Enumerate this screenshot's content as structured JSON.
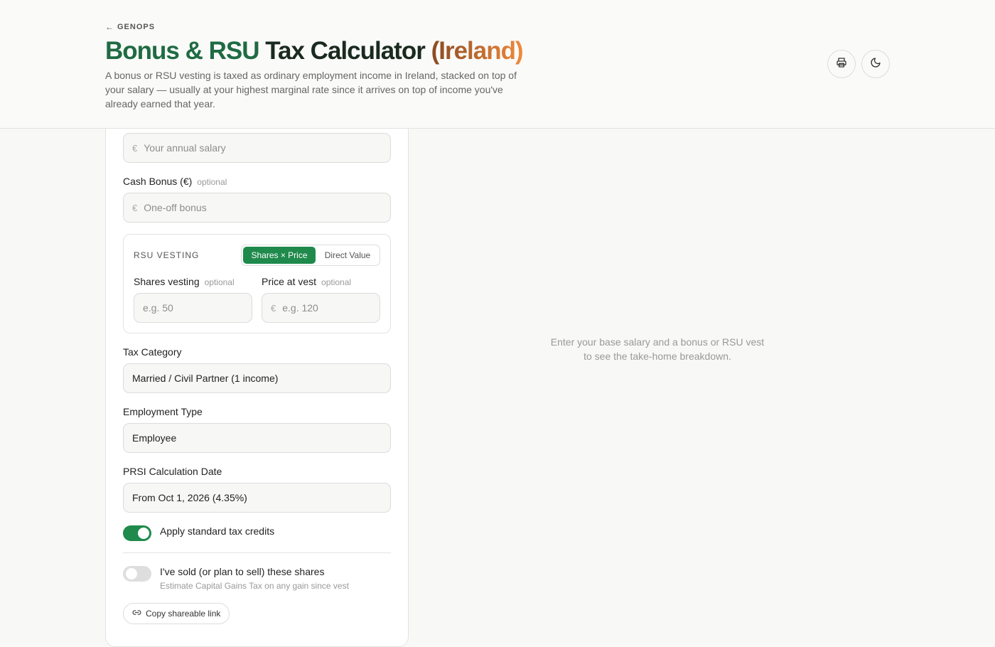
{
  "header": {
    "back_label": "GENOPS",
    "title_part1": "Bonus & RSU",
    "title_part2": "Tax Calculator",
    "title_part3": "(Ireland)",
    "subtitle": "A bonus or RSU vesting is taxed as ordinary employment income in Ireland, stacked on top of your salary — usually at your highest marginal rate since it arrives on top of income you've already earned that year."
  },
  "form": {
    "salary": {
      "currency": "€",
      "placeholder": "Your annual salary"
    },
    "cash_bonus": {
      "label": "Cash Bonus (€)",
      "optional": "optional",
      "currency": "€",
      "placeholder": "One-off bonus"
    },
    "rsu": {
      "title": "RSU VESTING",
      "modes": [
        "Shares × Price",
        "Direct Value"
      ],
      "shares_label": "Shares vesting",
      "shares_optional": "optional",
      "shares_placeholder": "e.g. 50",
      "price_label": "Price at vest",
      "price_optional": "optional",
      "price_currency": "€",
      "price_placeholder": "e.g. 120"
    },
    "tax_category": {
      "label": "Tax Category",
      "value": "Married / Civil Partner (1 income)"
    },
    "employment_type": {
      "label": "Employment Type",
      "value": "Employee"
    },
    "prsi_date": {
      "label": "PRSI Calculation Date",
      "value": "From Oct 1, 2026 (4.35%)"
    },
    "tax_credits_toggle": {
      "label": "Apply standard tax credits",
      "on": true
    },
    "sold_toggle": {
      "label": "I've sold (or plan to sell) these shares",
      "hint": "Estimate Capital Gains Tax on any gain since vest",
      "on": false
    },
    "copy_link_label": "Copy shareable link"
  },
  "results": {
    "empty_line1": "Enter your base salary and a bonus or RSU vest",
    "empty_line2": "to see the take-home breakdown."
  },
  "colors": {
    "accent": "#1f8a4c",
    "title_green": "#1f6b43",
    "title_orange": "#f08a3c"
  }
}
